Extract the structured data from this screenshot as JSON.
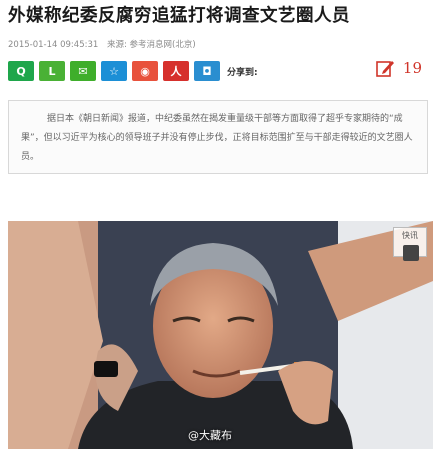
{
  "article": {
    "title": "外媒称纪委反腐穷追猛打将调查文艺圈人员",
    "timestamp": "2015-01-14 09:45:31",
    "source": "来源: 参考消息网(北京)",
    "summary": "据日本《朝日新闻》报道，中纪委虽然在揭发重量级干部等方面取得了超乎专家期待的“成果”，但以习近平为核心的领导班子并没有停止步伐，正将目标范围扩至与干部走得较近的文艺圈人员。"
  },
  "share": {
    "label": "分享到:",
    "buttons": [
      {
        "name": "qq-zone",
        "glyph": "Q",
        "color": "#1fa64b"
      },
      {
        "name": "qq-friend",
        "glyph": "L",
        "color": "#4ab135"
      },
      {
        "name": "wechat",
        "glyph": "✉",
        "color": "#3fae2b"
      },
      {
        "name": "qq-weibo",
        "glyph": "☆",
        "color": "#1c8fd6"
      },
      {
        "name": "sina-weibo",
        "glyph": "◉",
        "color": "#e8523c"
      },
      {
        "name": "renren",
        "glyph": "人",
        "color": "#d6302c"
      },
      {
        "name": "kaixin",
        "glyph": "◘",
        "color": "#2a8ed0"
      }
    ]
  },
  "comments": {
    "count": "19",
    "color": "#d0352a"
  },
  "photo": {
    "watermark": "@大藏布",
    "logo_text": "快讯"
  }
}
